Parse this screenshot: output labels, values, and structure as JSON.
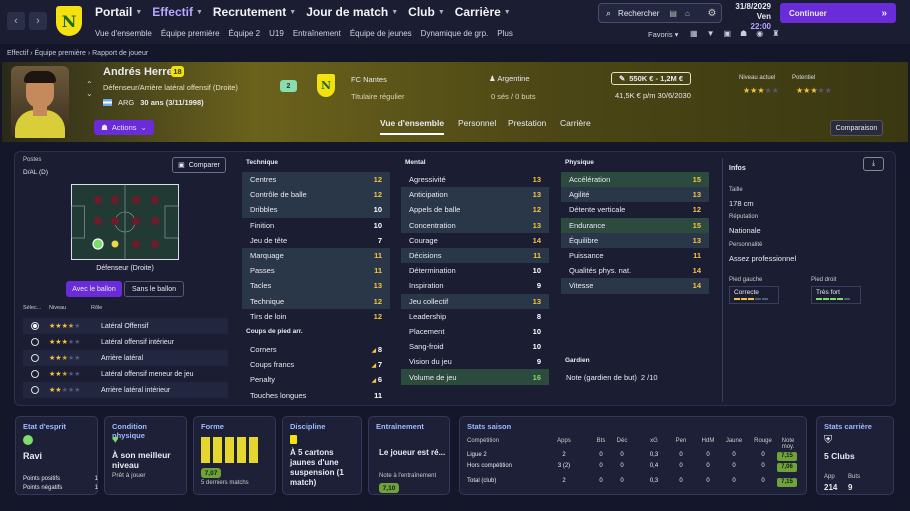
{
  "topbar": {
    "menu": [
      "Portail",
      "Effectif",
      "Recrutement",
      "Jour de match",
      "Club",
      "Carrière"
    ],
    "submenu": [
      "Vue d'ensemble",
      "Équipe première",
      "Équipe 2",
      "U19",
      "Entraînement",
      "Équipe de jeunes",
      "Dynamique de grp.",
      "Plus"
    ],
    "search": "Rechercher",
    "date": "31/8/2029",
    "day": "Ven",
    "time": "22:00",
    "continue": "Continuer",
    "favoris": "Favoris",
    "logo_text": "N",
    "logo_caption": "NANTES"
  },
  "breadcrumb": [
    "Effectif",
    "Équipe première",
    "Rapport de joueur"
  ],
  "player": {
    "name": "Andrés Herrera",
    "number": "18",
    "role": "Défenseur/Arrière latéral offensif (Droite)",
    "nation": "ARG",
    "age": "30 ans (3/11/1998)",
    "squad_no": "2",
    "club": "FC Nantes",
    "status": "Titulaire régulier",
    "country": "Argentine",
    "caps": "0 sés / 0 buts",
    "value": "550K € - 1,2M €",
    "wage": "41,5K € p/m 30/6/2030",
    "current_label": "Niveau actuel",
    "potential_label": "Potentiel",
    "actions": "Actions",
    "comparison": "Comparaison"
  },
  "tabs": [
    "Vue d'ensemble",
    "Personnel",
    "Prestation",
    "Carrière"
  ],
  "positions": {
    "label": "Postes",
    "value": "D/AL (D)",
    "compare": "Comparer",
    "caption": "Défenseur (Droite)",
    "with_ball": "Avec le ballon",
    "without_ball": "Sans le ballon",
    "col_sel": "Sélec...",
    "col_level": "Niveau",
    "col_role": "Rôle",
    "roles": [
      {
        "name": "Latéral Offensif",
        "stars": 3.5,
        "selected": true
      },
      {
        "name": "Latéral offensif intérieur",
        "stars": 3,
        "selected": false
      },
      {
        "name": "Arrière latéral",
        "stars": 2.5,
        "selected": false
      },
      {
        "name": "Latéral offensif meneur de jeu",
        "stars": 2.5,
        "selected": false
      },
      {
        "name": "Arrière latéral intérieur",
        "stars": 2,
        "selected": false
      }
    ]
  },
  "technique": {
    "title": "Technique",
    "rows": [
      [
        "Centres",
        "12"
      ],
      [
        "Contrôle de balle",
        "12"
      ],
      [
        "Dribbles",
        "10"
      ],
      [
        "Finition",
        "10"
      ],
      [
        "Jeu de tête",
        "7"
      ],
      [
        "Marquage",
        "11"
      ],
      [
        "Passes",
        "11"
      ],
      [
        "Tacles",
        "13"
      ],
      [
        "Technique",
        "12"
      ],
      [
        "Tirs de loin",
        "12"
      ]
    ]
  },
  "setpieces": {
    "title": "Coups de pied arr.",
    "rows": [
      [
        "Corners",
        "8"
      ],
      [
        "Coups francs",
        "7"
      ],
      [
        "Penalty",
        "6"
      ],
      [
        "Touches longues",
        "11"
      ]
    ]
  },
  "mental": {
    "title": "Mental",
    "rows": [
      [
        "Agressivité",
        "13"
      ],
      [
        "Anticipation",
        "13"
      ],
      [
        "Appels de balle",
        "12"
      ],
      [
        "Concentration",
        "13"
      ],
      [
        "Courage",
        "14"
      ],
      [
        "Décisions",
        "11"
      ],
      [
        "Détermination",
        "10"
      ],
      [
        "Inspiration",
        "9"
      ],
      [
        "Jeu collectif",
        "13"
      ],
      [
        "Leadership",
        "8"
      ],
      [
        "Placement",
        "10"
      ],
      [
        "Sang-froid",
        "10"
      ],
      [
        "Vision du jeu",
        "9"
      ],
      [
        "Volume de jeu",
        "16"
      ]
    ]
  },
  "physique": {
    "title": "Physique",
    "rows": [
      [
        "Accélération",
        "15"
      ],
      [
        "Agilité",
        "13"
      ],
      [
        "Détente verticale",
        "12"
      ],
      [
        "Endurance",
        "15"
      ],
      [
        "Équilibre",
        "13"
      ],
      [
        "Puissance",
        "11"
      ],
      [
        "Qualités phys. nat.",
        "14"
      ],
      [
        "Vitesse",
        "14"
      ]
    ]
  },
  "goalie": {
    "title": "Gardien",
    "row": "Note (gardien de but)",
    "value": "2 /10"
  },
  "info": {
    "title": "Infos",
    "height_label": "Taille",
    "height": "178 cm",
    "rep_label": "Réputation",
    "rep": "Nationale",
    "pers_label": "Personnalité",
    "pers": "Assez professionnel",
    "left_label": "Pied gauche",
    "left": "Correcte",
    "right_label": "Pied droit",
    "right": "Très fort"
  },
  "cards": {
    "morale_t": "Etat d'esprit",
    "morale": "Ravi",
    "pos_pts": "Points positifs",
    "pos_val": "1",
    "neg_pts": "Points négatifs",
    "neg_val": "1",
    "cond_t": "Condition physique",
    "cond": "À son meilleur niveau",
    "cond_sub": "Prêt à jouer",
    "form_t": "Forme",
    "form_val": "7,07",
    "form_sub": "5 derniers matchs",
    "disc_t": "Discipline",
    "disc": "À 5 cartons jaunes d'une suspension (1 match)",
    "train_t": "Entraînement",
    "train": "Le joueur est ré...",
    "train_sub": "Note à l'entraînement",
    "train_val": "7,10",
    "career_t": "Stats carrière",
    "career": "5 Clubs",
    "app_l": "App",
    "app": "214",
    "buts_l": "Buts",
    "buts": "9"
  },
  "season": {
    "title": "Stats saison",
    "headers": [
      "Compétition",
      "Apps",
      "Bts",
      "Déc",
      "xG",
      "Pen",
      "HdM",
      "Jaune",
      "Rouge",
      "Note moy."
    ],
    "rows": [
      [
        "Ligue 2",
        "2",
        "0",
        "0",
        "0,3",
        "0",
        "0",
        "0",
        "0",
        "7,15"
      ],
      [
        "Hors compétition",
        "3 (2)",
        "0",
        "0",
        "0,4",
        "0",
        "0",
        "0",
        "0",
        "7,06"
      ],
      [
        "Total (club)",
        "2",
        "0",
        "0",
        "0,3",
        "0",
        "0",
        "0",
        "0",
        "7,15"
      ]
    ]
  },
  "colors": {
    "accent": "#6a2bd9",
    "yellow": "#f4e10f",
    "highlight": "#2a3748",
    "green": "#7ddc6a"
  }
}
